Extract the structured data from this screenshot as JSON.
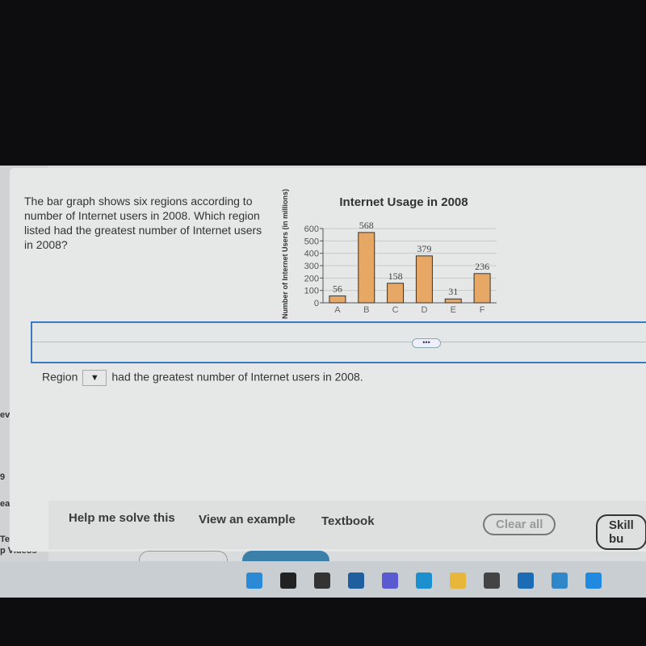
{
  "sidebar": {
    "items": [
      "eview",
      "9",
      "eady for t",
      "Test with",
      "p Videos"
    ]
  },
  "question": {
    "text": "The bar graph shows six regions according to number of Internet users in 2008. Which region listed had the greatest number of Internet users in 2008?"
  },
  "answer": {
    "prefix": "Region",
    "dropdown_icon": "▼",
    "suffix": "had the greatest number of Internet users in 2008.",
    "more_label": "•••"
  },
  "footer": {
    "help": "Help me solve this",
    "example": "View an example",
    "textbook": "Textbook",
    "clear": "Clear all",
    "skill": "Skill bu"
  },
  "taskbar": {
    "icons": [
      "windows-icon",
      "search-icon",
      "task-view-icon",
      "widgets-icon",
      "teams-icon",
      "edge-icon",
      "file-explorer-icon",
      "store-icon",
      "mail-icon",
      "app-icon",
      "app2-icon"
    ]
  },
  "chart_data": {
    "type": "bar",
    "title": "Internet Usage in 2008",
    "ylabel": "Number of Internet Users (in millions)",
    "xlabel": "",
    "categories": [
      "A",
      "B",
      "C",
      "D",
      "E",
      "F"
    ],
    "values": [
      56,
      568,
      158,
      379,
      31,
      236
    ],
    "ylim": [
      0,
      600
    ],
    "yticks": [
      0,
      100,
      200,
      300,
      400,
      500,
      600
    ],
    "bar_color": "#e8a865",
    "grid": true
  }
}
